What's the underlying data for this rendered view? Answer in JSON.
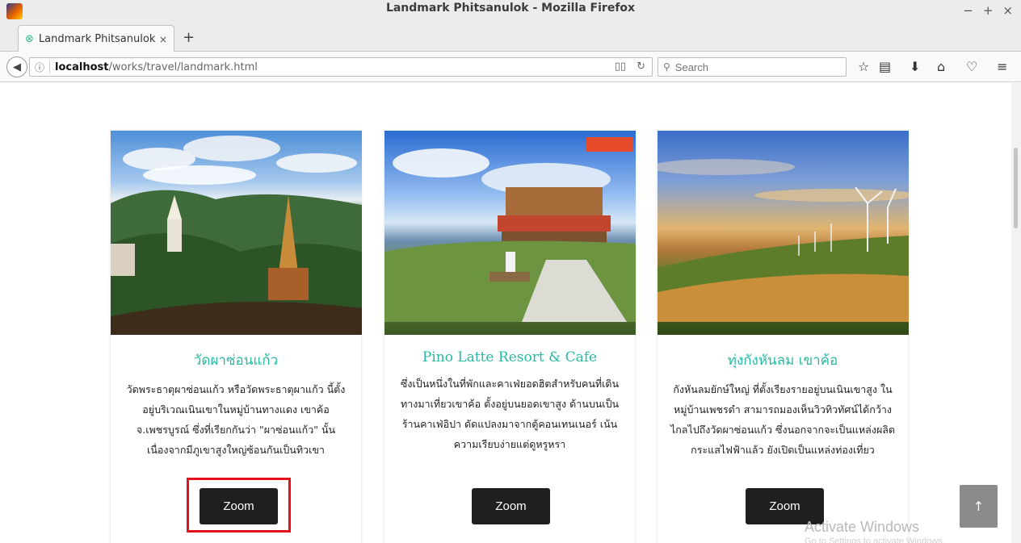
{
  "window": {
    "title": "Landmark Phitsanulok - Mozilla Firefox",
    "controls": [
      "−",
      "+",
      "×"
    ]
  },
  "tab": {
    "label": "Landmark Phitsanulok",
    "close": "×",
    "new_tab": "+"
  },
  "nav": {
    "url_host": "localhost",
    "url_path": "/works/travel/landmark.html",
    "search_placeholder": "Search"
  },
  "cards": [
    {
      "title": "วัดผาซ่อนแก้ว",
      "description": "วัดพระธาตุผาซ่อนแก้ว หรือวัดพระธาตุผาแก้ว นี้ตั้งอยู่บริเวณเนินเขาในหมู่บ้านทางแดง เขาค้อ จ.เพชรบูรณ์ ซึ่งที่เรียกกันว่า \"ผาซ่อนแก้ว\" นั้นเนื่องจากมีภูเขาสูงใหญ่ซ้อนกันเป็นทิวเขา",
      "button": "Zoom"
    },
    {
      "title": "Pino Latte Resort & Cafe",
      "description": "ซึ่งเป็นหนึ่งในที่พักและคาเฟ่ยอดฮิตสำหรับคนที่เดินทางมาเที่ยวเขาค้อ ตั้งอยู่บนยอดเขาสูง ด้านบนเป็นร้านคาเฟ่อิปา ดัดแปลงมาจากตู้คอนเทนเนอร์ เน้นความเรียบง่ายแต่ดูหรูหรา",
      "button": "Zoom"
    },
    {
      "title": "ทุ่งกังหันลม เขาค้อ",
      "description": "กังหันลมยักษ์ใหญ่ ที่ตั้งเรียงรายอยู่บนเนินเขาสูง ในหมู่บ้านเพชรดำ สามารถมองเห็นวิวทิวทัศน์ได้กว้างไกลไปถึงวัดผาซ่อนแก้ว ซึ่งนอกจากจะเป็นแหล่งผลิตกระแสไฟฟ้าแล้ว ยังเปิดเป็นแหล่งท่องเที่ยว",
      "button": "Zoom"
    }
  ],
  "watermark": {
    "line1": "Activate Windows",
    "line2": "Go to Settings to activate Windows."
  },
  "scroll_top": "↑",
  "colors": {
    "accent": "#28b9a3",
    "button": "#1f1f1f",
    "highlight": "#e3111b"
  }
}
